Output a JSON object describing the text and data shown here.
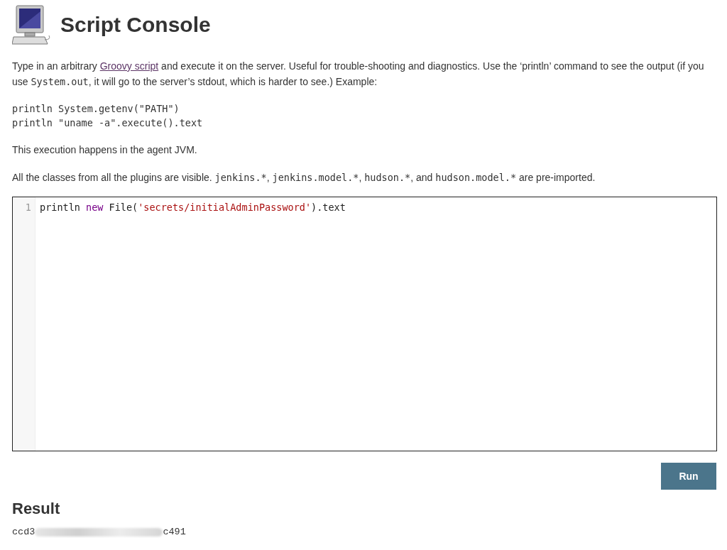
{
  "page": {
    "title": "Script Console"
  },
  "description": [
    {
      "kind": "text",
      "text": "Type in an arbitrary "
    },
    {
      "kind": "link",
      "text": "Groovy script"
    },
    {
      "kind": "text",
      "text": " and execute it on the server. Useful for trouble-shooting and diagnostics. Use the ‘println’ command to see the output (if you use "
    },
    {
      "kind": "code",
      "text": "System.out"
    },
    {
      "kind": "text",
      "text": ", it will go to the server’s stdout, which is harder to see.) Example:"
    }
  ],
  "example": [
    "println System.getenv(\"PATH\")",
    "println \"uname -a\".execute().text"
  ],
  "agent_note": "This execution happens in the agent JVM.",
  "imports_note": {
    "lead": "All the classes from all the plugins are visible. ",
    "packages": [
      {
        "code": "jenkins.*",
        "after": ", "
      },
      {
        "code": "jenkins.model.*",
        "after": ", "
      },
      {
        "code": "hudson.*",
        "after": ", and "
      },
      {
        "code": "hudson.model.*",
        "after": " are pre-imported."
      }
    ]
  },
  "editor": {
    "lines": [
      {
        "number": "1",
        "tokens": [
          {
            "kind": "plain",
            "text": "println "
          },
          {
            "kind": "keyword",
            "text": "new"
          },
          {
            "kind": "plain",
            "text": " File("
          },
          {
            "kind": "string",
            "text": "'secrets/initialAdminPassword'"
          },
          {
            "kind": "plain",
            "text": ").text"
          }
        ]
      }
    ]
  },
  "run_button": "Run",
  "result": {
    "heading": "Result",
    "start": "ccd3",
    "end": "c491",
    "redacted": true
  }
}
